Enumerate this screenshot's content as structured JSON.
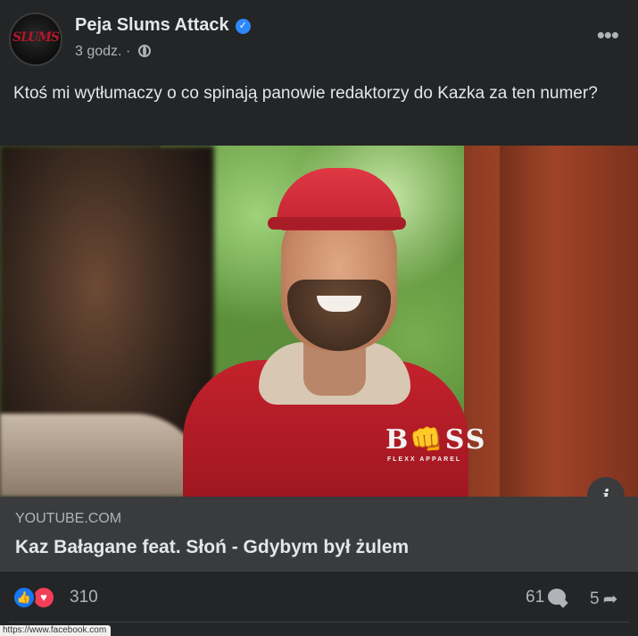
{
  "post": {
    "author": "Peja Slums Attack",
    "avatar_text": "SLUMS",
    "time": "3 godz.",
    "separator": "·",
    "more_label": "•••",
    "text": "Ktoś mi wytłumaczy o co spinają panowie redaktorzy do Kazka za ten numer?",
    "verified_mark": "✓"
  },
  "media": {
    "logo": "B👊SS",
    "logo_sub": "FLEXX APPAREL",
    "info_label": "i"
  },
  "link": {
    "domain": "YOUTUBE.COM",
    "title": "Kaz Bałagane feat. Słoń - Gdybym był żulem"
  },
  "stats": {
    "reactions": "310",
    "comments": "61",
    "shares": "5",
    "like_glyph": "👍",
    "love_glyph": "♥",
    "share_glyph": "➦"
  },
  "status_url": "https://www.facebook.com",
  "colors": {
    "background": "#242526",
    "link_box": "#3a3b3c",
    "verified": "#2d88ff",
    "like": "#1877f2",
    "love": "#f33e58"
  }
}
